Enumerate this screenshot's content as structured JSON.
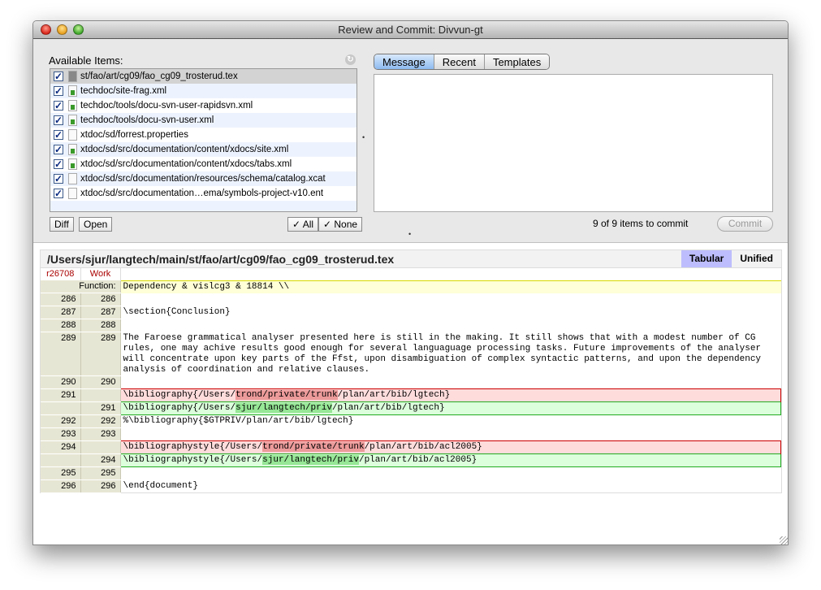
{
  "window": {
    "title": "Review and Commit: Divvun-gt"
  },
  "items_panel": {
    "label": "Available Items:",
    "items": [
      {
        "path": "st/fao/art/cg09/fao_cg09_trosterud.tex",
        "checked": true,
        "icon": "tex-file-icon",
        "selected": true
      },
      {
        "path": "techdoc/site-frag.xml",
        "checked": true,
        "icon": "modified-file-icon"
      },
      {
        "path": "techdoc/tools/docu-svn-user-rapidsvn.xml",
        "checked": true,
        "icon": "modified-file-icon"
      },
      {
        "path": "techdoc/tools/docu-svn-user.xml",
        "checked": true,
        "icon": "modified-file-icon"
      },
      {
        "path": "xtdoc/sd/forrest.properties",
        "checked": true,
        "icon": "file-icon"
      },
      {
        "path": "xtdoc/sd/src/documentation/content/xdocs/site.xml",
        "checked": true,
        "icon": "modified-file-icon"
      },
      {
        "path": "xtdoc/sd/src/documentation/content/xdocs/tabs.xml",
        "checked": true,
        "icon": "modified-file-icon"
      },
      {
        "path": "xtdoc/sd/src/documentation/resources/schema/catalog.xcat",
        "checked": true,
        "icon": "file-icon"
      },
      {
        "path": "xtdoc/sd/src/documentation…ema/symbols-project-v10.ent",
        "checked": true,
        "icon": "file-icon"
      }
    ],
    "buttons": {
      "diff": "Diff",
      "open": "Open",
      "all": "✓ All",
      "none": "✓ None"
    }
  },
  "message_panel": {
    "tabs": [
      "Message",
      "Recent",
      "Templates"
    ],
    "active_tab": "Message",
    "message_value": "",
    "status": "9 of 9 items to commit",
    "commit_label": "Commit"
  },
  "diff": {
    "file_path": "/Users/sjur/langtech/main/st/fao/art/cg09/fao_cg09_trosterud.tex",
    "view_tabs": [
      "Tabular",
      "Unified"
    ],
    "active_view": "Tabular",
    "left_rev": "r26708",
    "right_rev": "Work",
    "function_label": "Function:",
    "function_text": "Dependency & vislcg3 & 18814 \\\\",
    "lines": [
      {
        "type": "ctx",
        "l": "286",
        "r": "286",
        "text": ""
      },
      {
        "type": "ctx",
        "l": "287",
        "r": "287",
        "text": "\\section{Conclusion}"
      },
      {
        "type": "ctx",
        "l": "288",
        "r": "288",
        "text": ""
      },
      {
        "type": "ctx",
        "l": "289",
        "r": "289",
        "text": "The Faroese grammatical analyser presented here is still in the making. It still shows that with a modest number of CG rules, one may achive results good enough for several languaguage processing tasks. Future improvements of the analyser will concentrate upon key parts of the Ffst, upon disambiguation of complex syntactic patterns, and upon the dependency analysis of coordination and relative clauses."
      },
      {
        "type": "ctx",
        "l": "290",
        "r": "290",
        "text": ""
      },
      {
        "type": "del",
        "l": "291",
        "r": "",
        "pre": "\\bibliography{/Users/",
        "hl": "trond/private/trunk",
        "post": "/plan/art/bib/lgtech}"
      },
      {
        "type": "add",
        "l": "",
        "r": "291",
        "pre": "\\bibliography{/Users/",
        "hl": "sjur/langtech/priv",
        "post": "/plan/art/bib/lgtech}"
      },
      {
        "type": "ctx",
        "l": "292",
        "r": "292",
        "text": "%\\bibliography{$GTPRIV/plan/art/bib/lgtech}"
      },
      {
        "type": "ctx",
        "l": "293",
        "r": "293",
        "text": ""
      },
      {
        "type": "del",
        "l": "294",
        "r": "",
        "pre": "\\bibliographystyle{/Users/",
        "hl": "trond/private/trunk",
        "post": "/plan/art/bib/acl2005}"
      },
      {
        "type": "add",
        "l": "",
        "r": "294",
        "pre": "\\bibliographystyle{/Users/",
        "hl": "sjur/langtech/priv",
        "post": "/plan/art/bib/acl2005}"
      },
      {
        "type": "ctx",
        "l": "295",
        "r": "295",
        "text": ""
      },
      {
        "type": "ctx",
        "l": "296",
        "r": "296",
        "text": "\\end{document}"
      }
    ]
  }
}
